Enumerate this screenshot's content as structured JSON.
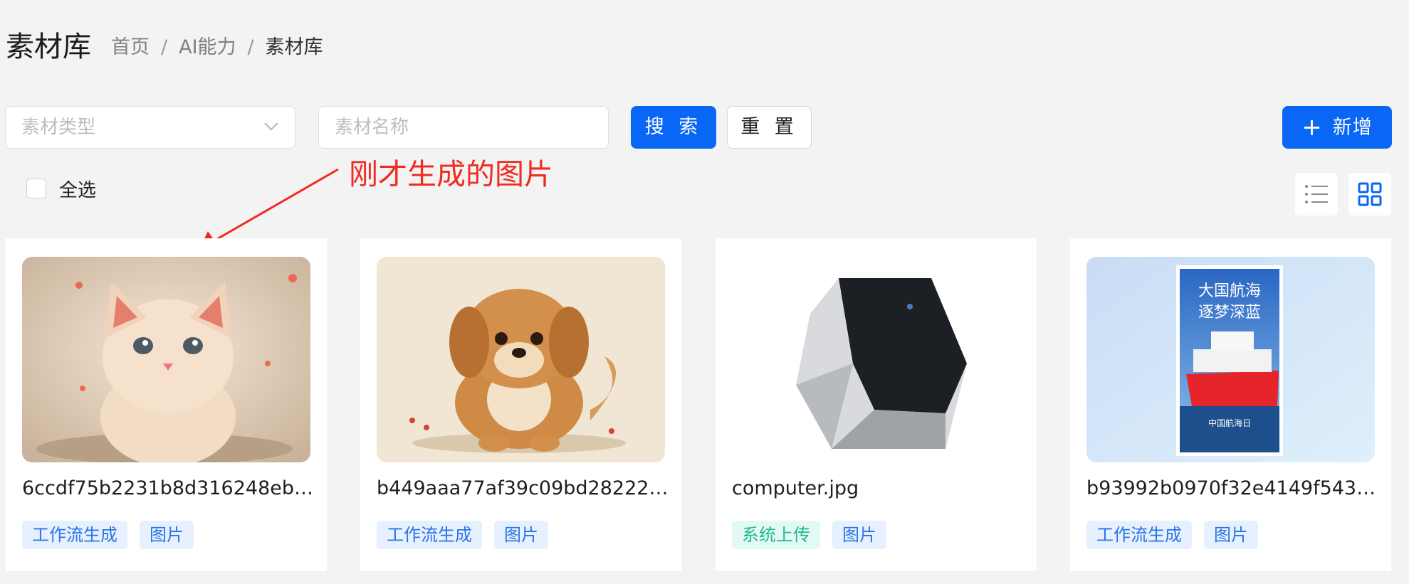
{
  "header": {
    "title": "素材库",
    "breadcrumb": [
      "首页",
      "AI能力",
      "素材库"
    ],
    "breadcrumb_sep": "/"
  },
  "filters": {
    "type_placeholder": "素材类型",
    "name_placeholder": "素材名称",
    "search_label": "搜 索",
    "reset_label": "重 置",
    "add_label": "新增"
  },
  "select_all_label": "全选",
  "annotation_text": "刚才生成的图片",
  "colors": {
    "primary": "#0a66f5",
    "annotation": "#ef2b22",
    "tag_blue": "#2a74e6",
    "tag_green": "#1fb88c"
  },
  "cards": [
    {
      "name": "6ccdf75b2231b8d316248ebe59...",
      "thumb": "kitten-illustration",
      "tags": [
        "工作流生成",
        "图片"
      ]
    },
    {
      "name": "b449aaa77af39c09bd28222a4b...",
      "thumb": "puppy-illustration",
      "tags": [
        "工作流生成",
        "图片"
      ]
    },
    {
      "name": "computer.jpg",
      "thumb": "computer-case-photo",
      "tags": [
        "系统上传",
        "图片"
      ]
    },
    {
      "name": "b93992b0970f32e4149f543466...",
      "thumb": "ship-poster",
      "tags": [
        "工作流生成",
        "图片"
      ]
    }
  ],
  "poster": {
    "line1": "大国航海",
    "line2": "逐梦深蓝",
    "footer": "中国航海日"
  }
}
